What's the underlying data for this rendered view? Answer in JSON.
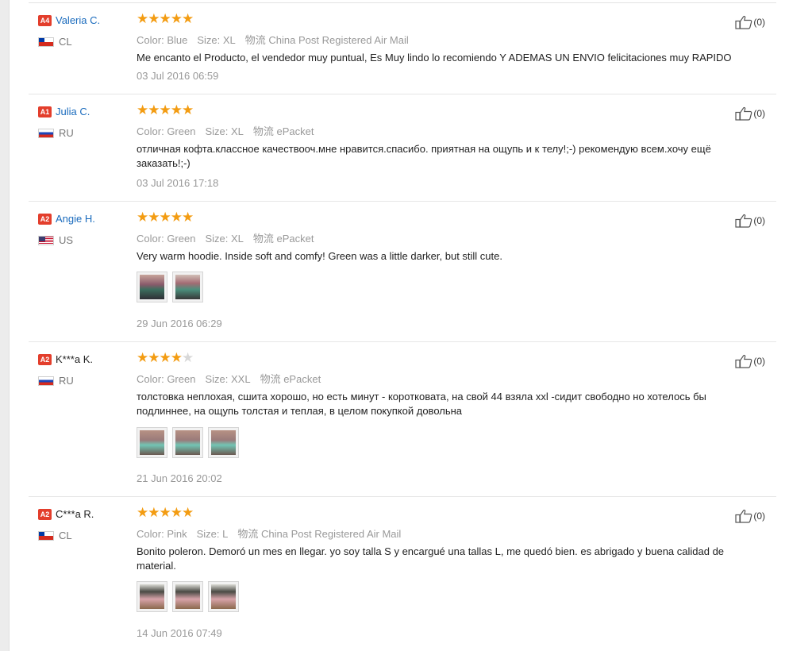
{
  "reviews": [
    {
      "level": "A4",
      "name": "Valeria C.",
      "name_style": "link",
      "country": "CL",
      "flag": "cl",
      "rating": 5,
      "labels": {
        "color": "Color:",
        "size": "Size:",
        "logistics": "物流"
      },
      "color": "Blue",
      "size": "XL",
      "shipping": "China Post Registered Air Mail",
      "text": "Me encanto el Producto, el vendedor muy puntual, Es Muy lindo lo recomiendo Y ADEMAS UN ENVIO felicitaciones muy RAPIDO",
      "photos": [],
      "date": "03 Jul 2016 06:59",
      "helpful": "(0)"
    },
    {
      "level": "A1",
      "name": "Julia C.",
      "name_style": "link",
      "country": "RU",
      "flag": "ru",
      "rating": 5,
      "labels": {
        "color": "Color:",
        "size": "Size:",
        "logistics": "物流"
      },
      "color": "Green",
      "size": "XL",
      "shipping": "ePacket",
      "text": "отличная кофта.классное качествооч.мне нравится.спасибо. приятная на ощупь и к телу!;-) рекомендую всем.хочу ещё заказать!;-)",
      "photos": [],
      "date": "03 Jul 2016 17:18",
      "helpful": "(0)"
    },
    {
      "level": "A2",
      "name": "Angie H.",
      "name_style": "link",
      "country": "US",
      "flag": "us",
      "rating": 5,
      "labels": {
        "color": "Color:",
        "size": "Size:",
        "logistics": "物流"
      },
      "color": "Green",
      "size": "XL",
      "shipping": "ePacket",
      "text": "Very warm hoodie. Inside soft and comfy! Green was a little darker, but still cute.",
      "photos": [
        "t-hoodie-a",
        "t-hoodie-b"
      ],
      "date": "29 Jun 2016 06:29",
      "helpful": "(0)"
    },
    {
      "level": "A2",
      "name": "K***a K.",
      "name_style": "plain",
      "country": "RU",
      "flag": "ru",
      "rating": 4,
      "labels": {
        "color": "Color:",
        "size": "Size:",
        "logistics": "物流"
      },
      "color": "Green",
      "size": "XXL",
      "shipping": "ePacket",
      "text": "толстовка неплохая, сшита хорошо, но есть минут - коротковата, на свой 44 взяла xxl -сидит свободно но хотелось бы подлиннее, на ощупь толстая и теплая, в целом покупкой довольна",
      "photos": [
        "t-ru",
        "t-ru",
        "t-ru"
      ],
      "date": "21 Jun 2016 20:02",
      "helpful": "(0)"
    },
    {
      "level": "A2",
      "name": "C***a R.",
      "name_style": "plain",
      "country": "CL",
      "flag": "cl",
      "rating": 5,
      "labels": {
        "color": "Color:",
        "size": "Size:",
        "logistics": "物流"
      },
      "color": "Pink",
      "size": "L",
      "shipping": "China Post Registered Air Mail",
      "text": "Bonito poleron. Demoró un mes en llegar. yo soy talla S y encargué una tallas L, me quedó bien. es abrigado y buena calidad de material.",
      "photos": [
        "t-pink",
        "t-pink",
        "t-pink"
      ],
      "date": "14 Jun 2016 07:49",
      "helpful": "(0)"
    }
  ],
  "colors": {
    "link": "#1a6bbd",
    "star": "#f39c12",
    "level_badge": "#e33e2c"
  },
  "icons": {
    "like": "thumbs-up-icon",
    "star": "star-icon"
  }
}
